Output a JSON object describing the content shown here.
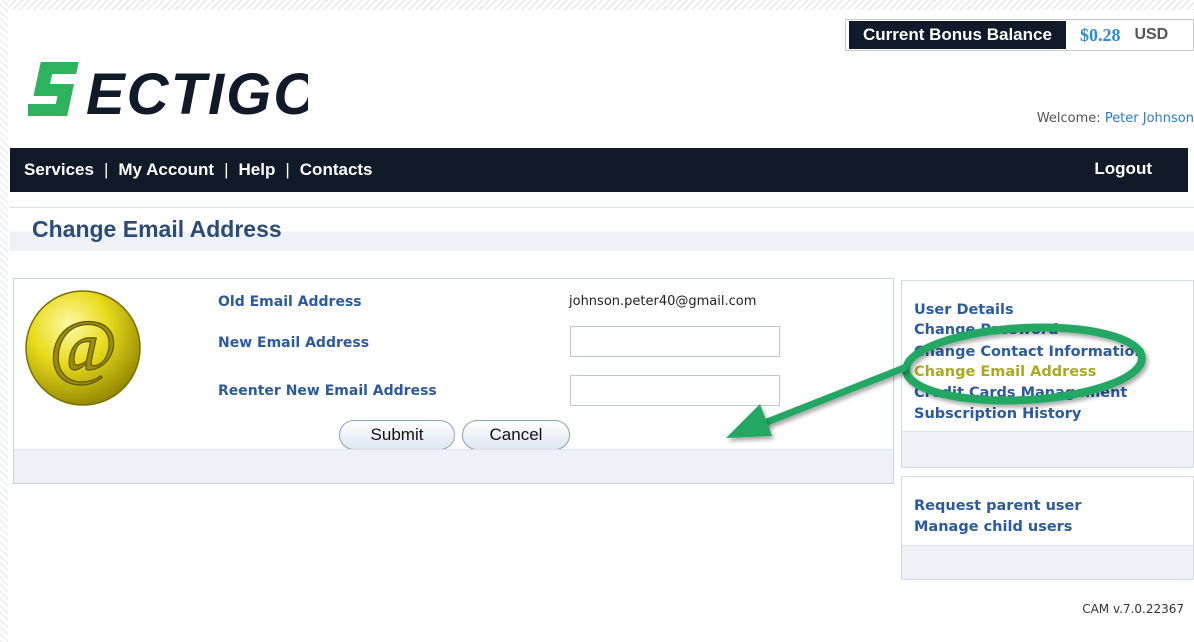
{
  "bonus": {
    "label": "Current Bonus Balance",
    "value": "$0.28",
    "currency": "USD"
  },
  "brand": {
    "logo_text": "SECTIGO",
    "logo_color": "#2db35d",
    "logo_dark": "#101a28"
  },
  "welcome": {
    "prefix": "Welcome: ",
    "user": "Peter Johnson"
  },
  "nav": {
    "items": [
      "Services",
      "My Account",
      "Help",
      "Contacts"
    ],
    "separator": "|",
    "logout": "Logout"
  },
  "page": {
    "title": "Change Email Address"
  },
  "form": {
    "old_email_label": "Old Email Address",
    "old_email_value": "johnson.peter40@gmail.com",
    "new_email_label": "New Email Address",
    "new_email_value": "",
    "reenter_label": "Reenter New Email Address",
    "reenter_value": "",
    "submit_label": "Submit",
    "cancel_label": "Cancel"
  },
  "sidebar": {
    "account_links": [
      "User Details",
      "Change Password",
      "Change Contact Information",
      "Change Email Address",
      "Credit Cards Management",
      "Subscription History"
    ],
    "active_index": 3,
    "user_links": [
      "Request parent user",
      "Manage child users"
    ]
  },
  "footer": {
    "version": "CAM v.7.0.22367"
  },
  "colors": {
    "nav_bg": "#101a28",
    "link": "#2c5aa0",
    "annotation": "#22a862"
  }
}
